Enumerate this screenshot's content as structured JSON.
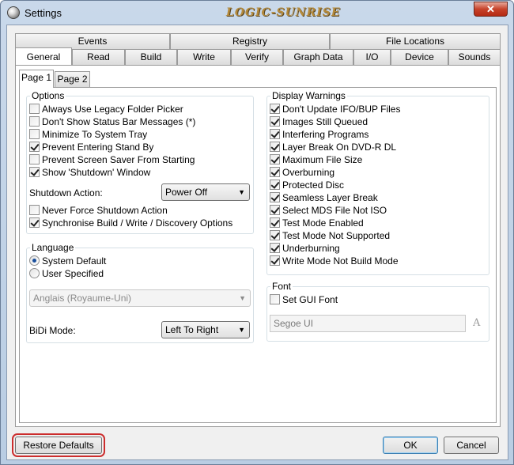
{
  "window": {
    "title": "Settings",
    "watermark": "LOGIC-SUNRISE",
    "close_glyph": "✕",
    "icon": "app-disc-icon"
  },
  "tabs_top": [
    "Events",
    "Registry",
    "File Locations"
  ],
  "tabs_bottom": [
    "General",
    "Read",
    "Build",
    "Write",
    "Verify",
    "Graph Data",
    "I/O",
    "Device",
    "Sounds"
  ],
  "active_tab": "General",
  "subtabs": [
    "Page 1",
    "Page 2"
  ],
  "active_subtab": "Page 1",
  "options": {
    "title": "Options",
    "items": [
      {
        "label": "Always Use Legacy Folder Picker",
        "checked": false
      },
      {
        "label": "Don't Show Status Bar Messages (*)",
        "checked": false
      },
      {
        "label": "Minimize To System Tray",
        "checked": false
      },
      {
        "label": "Prevent Entering Stand By",
        "checked": true
      },
      {
        "label": "Prevent Screen Saver From Starting",
        "checked": false
      },
      {
        "label": "Show 'Shutdown' Window",
        "checked": true
      }
    ],
    "shutdown_label": "Shutdown Action:",
    "shutdown_value": "Power Off",
    "items2": [
      {
        "label": "Never Force Shutdown Action",
        "checked": false
      },
      {
        "label": "Synchronise Build / Write / Discovery Options",
        "checked": true
      }
    ]
  },
  "language": {
    "title": "Language",
    "system_default": "System Default",
    "user_specified": "User Specified",
    "selected": "System Default",
    "lang_value": "Anglais (Royaume-Uni)",
    "bidi_label": "BiDi Mode:",
    "bidi_value": "Left To Right"
  },
  "display_warnings": {
    "title": "Display Warnings",
    "items": [
      {
        "label": "Don't Update IFO/BUP Files",
        "checked": true
      },
      {
        "label": "Images Still Queued",
        "checked": true
      },
      {
        "label": "Interfering Programs",
        "checked": true
      },
      {
        "label": "Layer Break On DVD-R DL",
        "checked": true
      },
      {
        "label": "Maximum File Size",
        "checked": true
      },
      {
        "label": "Overburning",
        "checked": true
      },
      {
        "label": "Protected Disc",
        "checked": true
      },
      {
        "label": "Seamless Layer Break",
        "checked": true
      },
      {
        "label": "Select MDS File Not ISO",
        "checked": true
      },
      {
        "label": "Test Mode Enabled",
        "checked": true
      },
      {
        "label": "Test Mode Not Supported",
        "checked": true
      },
      {
        "label": "Underburning",
        "checked": true
      },
      {
        "label": "Write Mode Not Build Mode",
        "checked": true
      }
    ]
  },
  "font": {
    "title": "Font",
    "set_gui_font": "Set GUI Font",
    "set_gui_font_checked": false,
    "font_name": "Segoe UI",
    "font_icon_glyph": "A"
  },
  "buttons": {
    "restore": "Restore Defaults",
    "ok": "OK",
    "cancel": "Cancel"
  },
  "arrow_glyph": "▼"
}
